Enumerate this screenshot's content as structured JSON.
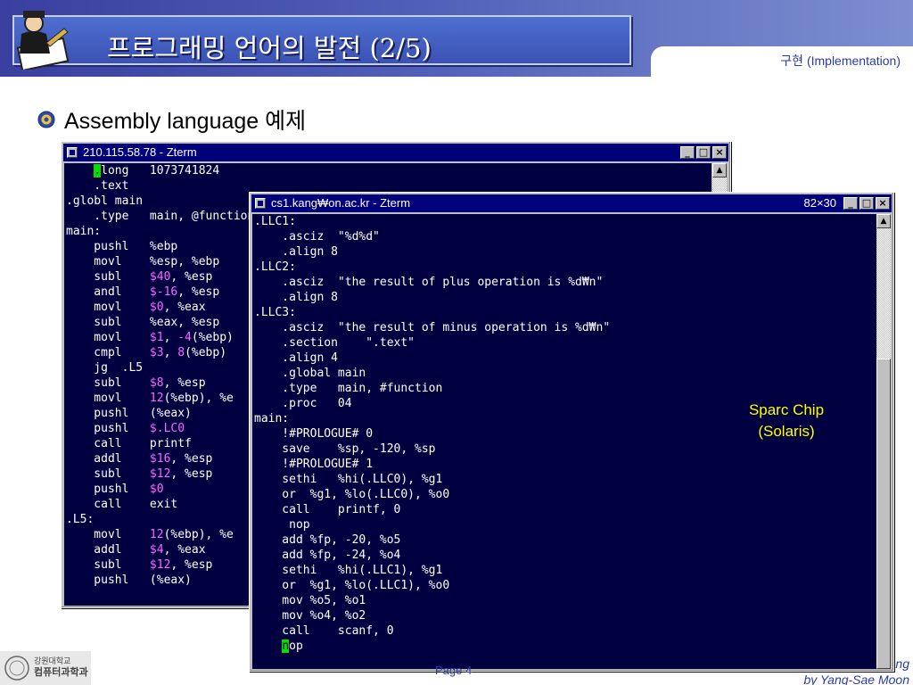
{
  "slide": {
    "title": "프로그래밍 언어의 발전 (2/5)",
    "subtitle": "구현 (Implementation)",
    "bullet": "Assembly language 예제",
    "annotation_line1": "Sparc Chip",
    "annotation_line2": "(Solaris)",
    "footer_page": "Page 4",
    "footer_line1": "ng",
    "footer_line2": "by Yang-Sae Moon",
    "footer_logo_line1": "강원대학교",
    "footer_logo_line2": "컴퓨터과학과"
  },
  "back_window": {
    "title": "210.115.58.78 - Zterm",
    "lines": [
      "    .long   1073741824",
      "    .text",
      ".globl main",
      "    .type   main, @function",
      "main:",
      "    pushl   %ebp",
      "    movl    %esp, %ebp",
      "    subl    $40, %esp",
      "    andl    $-16, %esp",
      "    movl    $0, %eax",
      "    subl    %eax, %esp",
      "    movl    $1, -4(%ebp)",
      "    cmpl    $3, 8(%ebp)",
      "    jg  .L5",
      "    subl    $8, %esp",
      "    movl    12(%ebp), %e",
      "    pushl   (%eax)",
      "    pushl   $.LC0",
      "    call    printf",
      "    addl    $16, %esp",
      "    subl    $12, %esp",
      "    pushl   $0",
      "    call    exit",
      ".L5:",
      "    movl    12(%ebp), %e",
      "    addl    $4, %eax",
      "    subl    $12, %esp",
      "    pushl   (%eax)"
    ]
  },
  "front_window": {
    "title": "cs1.kang₩on.ac.kr - Zterm",
    "size": "82×30",
    "lines": [
      ".LLC1:",
      "    .asciz  \"%d%d\"",
      "    .align 8",
      ".LLC2:",
      "    .asciz  \"the result of plus operation is %d₩n\"",
      "    .align 8",
      ".LLC3:",
      "    .asciz  \"the result of minus operation is %d₩n\"",
      "    .section    \".text\"",
      "    .align 4",
      "    .global main",
      "    .type   main, #function",
      "    .proc   04",
      "main:",
      "    !#PROLOGUE# 0",
      "    save    %sp, -120, %sp",
      "    !#PROLOGUE# 1",
      "    sethi   %hi(.LLC0), %g1",
      "    or  %g1, %lo(.LLC0), %o0",
      "    call    printf, 0",
      "     nop",
      "    add %fp, -20, %o5",
      "    add %fp, -24, %o4",
      "    sethi   %hi(.LLC1), %g1",
      "    or  %g1, %lo(.LLC1), %o0",
      "    mov %o5, %o1",
      "    mov %o4, %o2",
      "    call    scanf, 0",
      "    nop"
    ]
  },
  "colors": {
    "terminal_bg": "#000040",
    "title_bar": "#00007b",
    "cursor": "#00e000",
    "highlight": "#ff66ff",
    "annotation": "#ffff00"
  }
}
